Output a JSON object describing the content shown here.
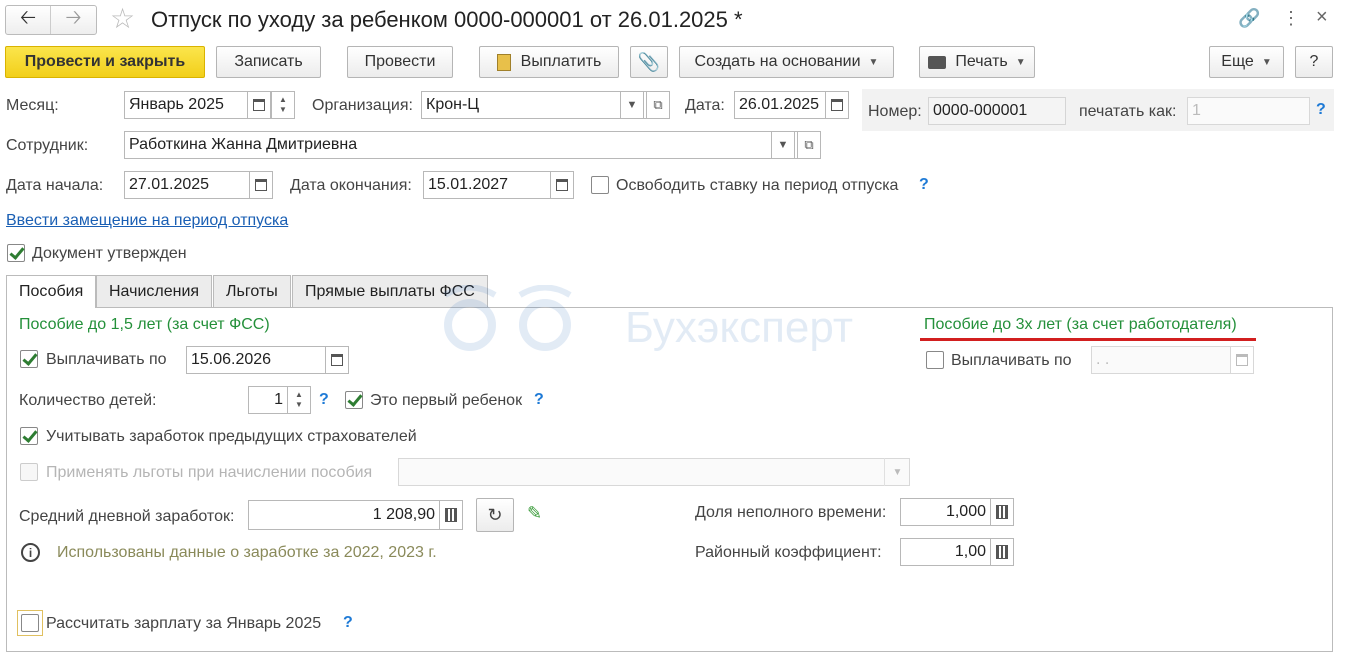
{
  "window": {
    "title": "Отпуск по уходу за ребенком 0000-000001 от 26.01.2025 *"
  },
  "toolbar": {
    "post_close": "Провести и закрыть",
    "save": "Записать",
    "post": "Провести",
    "pay": "Выплатить",
    "create_based": "Создать на основании",
    "print": "Печать",
    "more": "Еще",
    "help": "?"
  },
  "header": {
    "month_label": "Месяц:",
    "month_value": "Январь 2025",
    "org_label": "Организация:",
    "org_value": "Крон-Ц",
    "date_label": "Дата:",
    "date_value": "26.01.2025",
    "number_label": "Номер:",
    "number_value": "0000-000001",
    "print_as_label": "печатать как:",
    "print_as_placeholder": "1",
    "employee_label": "Сотрудник:",
    "employee_value": "Работкина Жанна Дмитриевна",
    "start_label": "Дата начала:",
    "start_value": "27.01.2025",
    "end_label": "Дата окончания:",
    "end_value": "15.01.2027",
    "free_rate_label": "Освободить ставку на период отпуска",
    "replacement_link": "Ввести замещение на период отпуска",
    "approved_label": "Документ утвержден",
    "help_q": "?"
  },
  "tabs": [
    {
      "label": "Пособия"
    },
    {
      "label": "Начисления"
    },
    {
      "label": "Льготы"
    },
    {
      "label": "Прямые выплаты ФСС"
    }
  ],
  "benefits": {
    "fss_title": "Пособие до 1,5 лет (за счет ФСС)",
    "pay_until_label": "Выплачивать по",
    "pay_until_value": "15.06.2026",
    "children_label": "Количество детей:",
    "children_value": "1",
    "first_child_label": "Это первый ребенок",
    "prev_insurers_label": "Учитывать заработок предыдущих страхователей",
    "apply_benefits_label": "Применять льготы при начислении пособия",
    "avg_daily_label": "Средний дневной заработок:",
    "avg_daily_value": "1 208,90",
    "info_text": "Использованы данные о заработке за  2022,  2023 г.",
    "part_time_label": "Доля неполного времени:",
    "part_time_value": "1,000",
    "district_label": "Районный коэффициент:",
    "district_value": "1,00",
    "employer_title": "Пособие до 3х лет (за счет работодателя)",
    "employer_pay_label": "Выплачивать по",
    "employer_pay_value": " .  .",
    "recalc_label": "Рассчитать зарплату за Январь 2025"
  },
  "watermark": "Бухэксперт",
  "colors": {
    "primary_button": "#f2cf1a",
    "section_green": "#24903a",
    "link_blue": "#1a5fb4",
    "underline_red": "#d21f1f"
  }
}
